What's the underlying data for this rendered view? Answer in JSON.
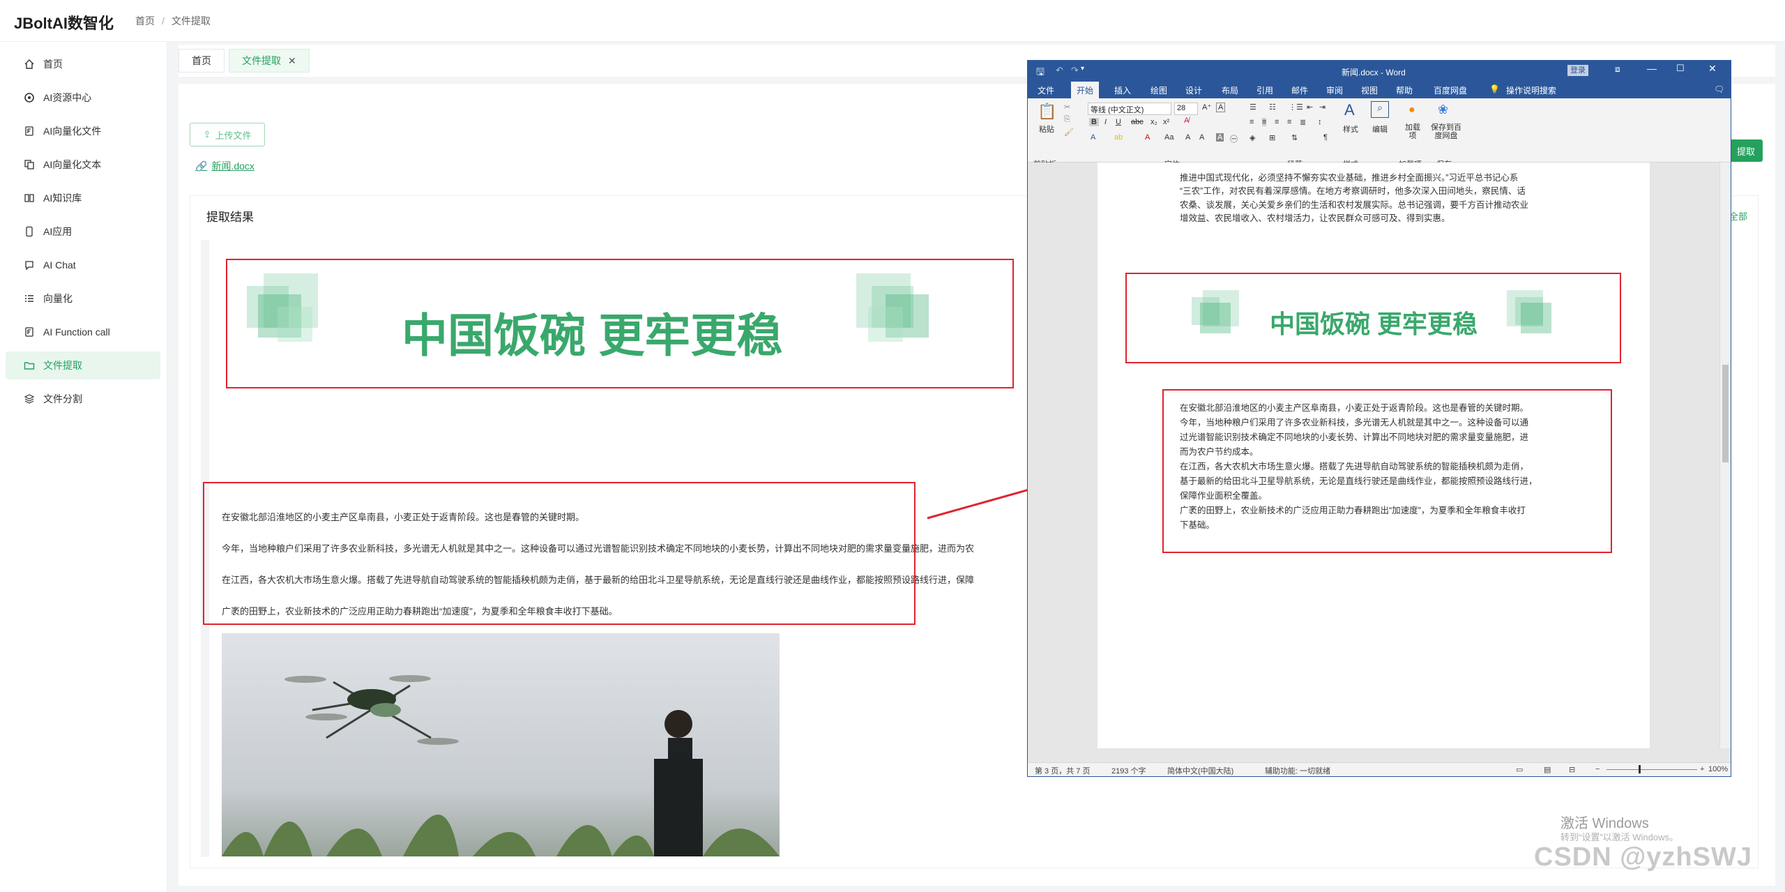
{
  "app": {
    "title": "JBoltAI数智化"
  },
  "breadcrumb": {
    "home": "首页",
    "current": "文件提取"
  },
  "sidebar": {
    "items": [
      {
        "label": "首页",
        "icon": "home-icon"
      },
      {
        "label": "AI资源中心",
        "icon": "openai-icon"
      },
      {
        "label": "AI向量化文件",
        "icon": "file-f-icon"
      },
      {
        "label": "AI向量化文本",
        "icon": "copy-icon"
      },
      {
        "label": "AI知识库",
        "icon": "book-icon"
      },
      {
        "label": "AI应用",
        "icon": "phone-icon"
      },
      {
        "label": "AI Chat",
        "icon": "chat-icon"
      },
      {
        "label": "向量化",
        "icon": "list-icon"
      },
      {
        "label": "AI Function call",
        "icon": "file-f-icon"
      },
      {
        "label": "文件提取",
        "icon": "folder-icon"
      },
      {
        "label": "文件分割",
        "icon": "layers-icon"
      }
    ],
    "active_index": 9
  },
  "tabs": [
    {
      "label": "首页"
    },
    {
      "label": "文件提取",
      "closable": true
    }
  ],
  "upload": {
    "button_label": "上传文件",
    "file_name": "新闻.docx"
  },
  "extract_button": {
    "label": "提取"
  },
  "result": {
    "title": "提取结果",
    "all_label": "全部",
    "banner_text": "中国饭碗 更牢更稳",
    "paragraphs": [
      "在安徽北部沿淮地区的小麦主产区阜南县，小麦正处于返青阶段。这也是春管的关键时期。",
      "今年，当地种粮户们采用了许多农业新科技，多光谱无人机就是其中之一。这种设备可以通过光谱智能识别技术确定不同地块的小麦长势，计算出不同地块对肥的需求量变量施肥，进而为农",
      "在江西，各大农机大市场生意火爆。搭载了先进导航自动驾驶系统的智能插秧机颇为走俏，基于最新的给田北斗卫星导航系统，无论是直线行驶还是曲线作业，都能按照预设路线行进，保障",
      "广袤的田野上，农业新技术的广泛应用正助力春耕跑出“加速度”，为夏季和全年粮食丰收打下基础。"
    ]
  },
  "word": {
    "window_title": "新闻.docx  -  Word",
    "login_label": "登录",
    "ribbon_tabs": [
      "文件",
      "开始",
      "插入",
      "绘图",
      "设计",
      "布局",
      "引用",
      "邮件",
      "审阅",
      "视图",
      "帮助",
      "百度网盘",
      "操作说明搜索"
    ],
    "font_name": "等线 (中文正文)",
    "font_size": "28",
    "paste_label": "粘贴",
    "styles_label": "样式",
    "edit_label": "编辑",
    "addin_label": "加载项",
    "save_to_label": "保存到百度网盘",
    "groups": [
      "剪贴板",
      "字体",
      "段落",
      "样式",
      "加载项",
      "保存"
    ],
    "top_lines": [
      "推进中国式现代化，必须坚持不懈夯实农业基础，推进乡村全面振兴。”习近平总书记心系",
      "“三农”工作，对农民有着深厚感情。在地方考察调研时，他多次深入田间地头，察民情、话",
      "农桑、谈发展，关心关爱乡亲们的生活和农村发展实际。总书记强调，要千方百计推动农业",
      "增效益、农民增收入、农村增活力，让农民群众可感可及、得到实惠。"
    ],
    "body_lines": [
      "在安徽北部沿淮地区的小麦主产区阜南县，小麦正处于返青阶段。这也是春管的关键时期。",
      "今年，当地种粮户们采用了许多农业新科技，多光谱无人机就是其中之一。这种设备可以通",
      "过光谱智能识别技术确定不同地块的小麦长势、计算出不同地块对肥的需求量变量施肥，进",
      "而为农户节约成本。",
      "在江西，各大农机大市场生意火爆。搭载了先进导航自动驾驶系统的智能插秧机颇为走俏，",
      "基于最新的给田北斗卫星导航系统，无论是直线行驶还是曲线作业，都能按照预设路线行进，",
      "保障作业面积全覆盖。",
      "广袤的田野上，农业新技术的广泛应用正助力春耕跑出“加速度”，为夏季和全年粮食丰收打",
      "下基础。"
    ],
    "status": {
      "page": "第 3 页，共 7 页",
      "words": "2193 个字",
      "lang": "简体中文(中国大陆)",
      "access": "辅助功能: 一切就绪",
      "zoom": "100%"
    }
  },
  "watermark": {
    "line1": "激活 Windows",
    "line2": "转到“设置”以激活 Windows。",
    "csdn": "CSDN @yzhSWJ"
  }
}
